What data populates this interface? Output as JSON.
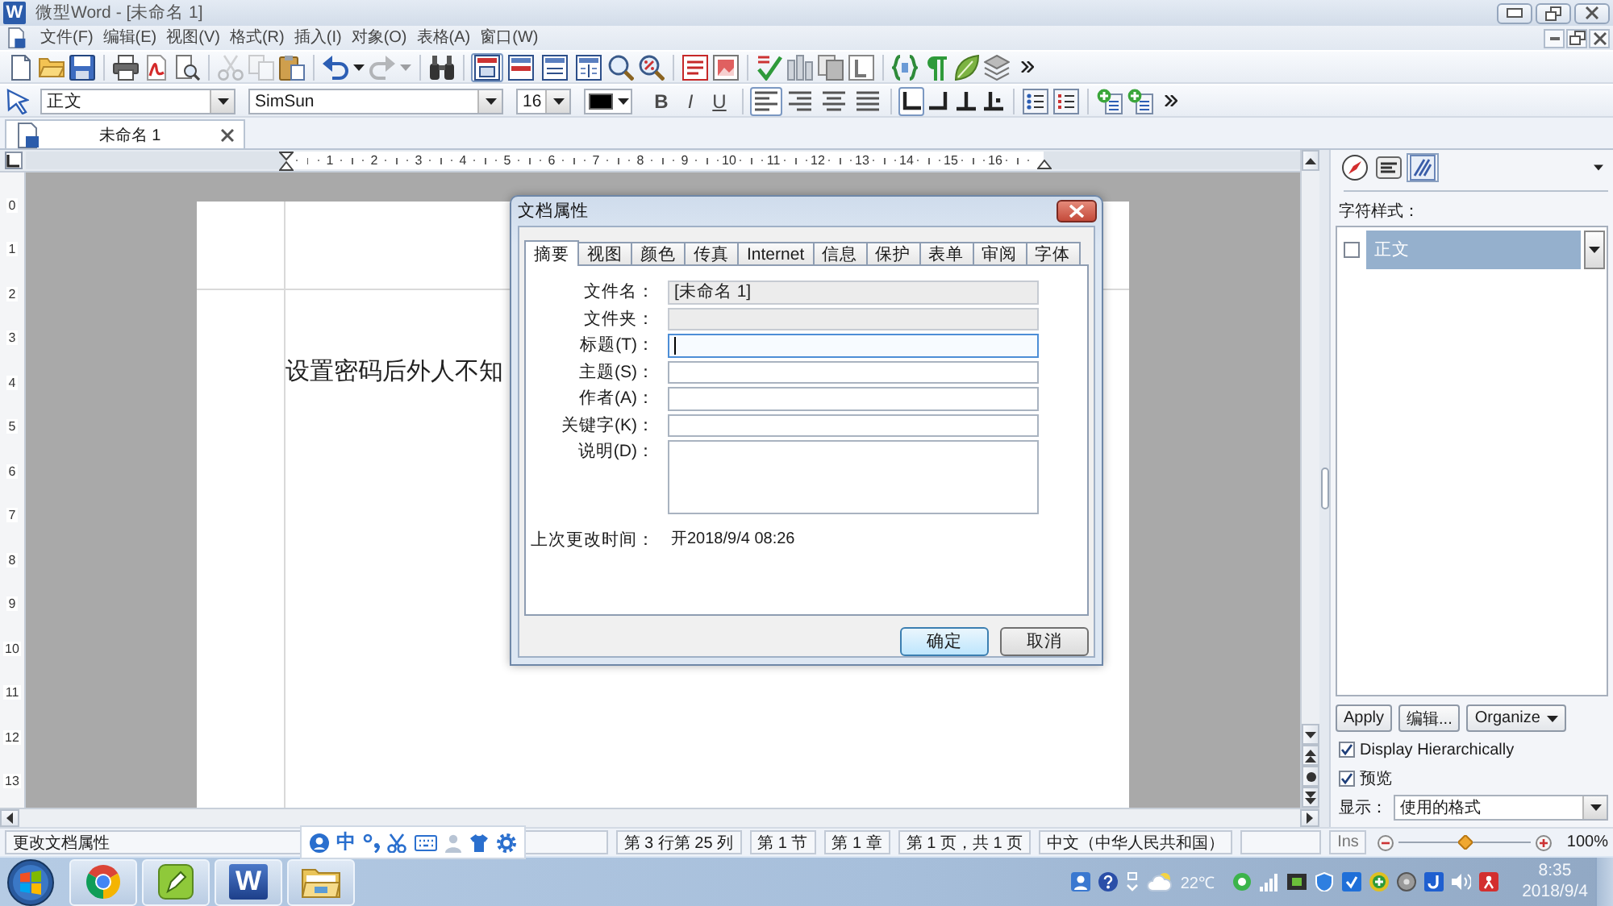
{
  "window": {
    "title": "微型Word - [未命名 1]",
    "app_badge": "W"
  },
  "menu_bar": {
    "items": [
      "文件(F)",
      "编辑(E)",
      "视图(V)",
      "格式(R)",
      "插入(I)",
      "对象(O)",
      "表格(A)",
      "窗口(W)"
    ]
  },
  "standard_toolbar": {
    "groups": [
      [
        {
          "kind": "new",
          "disabled": false
        },
        {
          "kind": "open",
          "disabled": false
        },
        {
          "kind": "save",
          "disabled": false
        }
      ],
      [
        {
          "kind": "print",
          "disabled": false
        },
        {
          "kind": "pdf",
          "disabled": false
        },
        {
          "kind": "preview",
          "disabled": false
        }
      ],
      [
        {
          "kind": "cut",
          "disabled": true
        },
        {
          "kind": "copy",
          "disabled": true
        },
        {
          "kind": "paste",
          "disabled": false
        }
      ],
      [
        {
          "kind": "undo",
          "disabled": false
        },
        {
          "kind": "menu",
          "disabled": false
        },
        {
          "kind": "redo",
          "disabled": true
        },
        {
          "kind": "menu",
          "disabled": true
        }
      ],
      [
        {
          "kind": "find",
          "disabled": false
        }
      ],
      [
        {
          "kind": "page-view",
          "selected": true,
          "disabled": false
        },
        {
          "kind": "web-view",
          "selected": false,
          "disabled": false
        },
        {
          "kind": "outline-view",
          "selected": false,
          "disabled": false
        },
        {
          "kind": "normal-view",
          "selected": false,
          "disabled": false
        },
        {
          "kind": "zoom",
          "disabled": false
        },
        {
          "kind": "zoom-percent",
          "disabled": false
        }
      ],
      [
        {
          "kind": "text-box",
          "disabled": false
        },
        {
          "kind": "image",
          "disabled": false
        }
      ],
      [
        {
          "kind": "spell-check",
          "disabled": false
        },
        {
          "kind": "columns",
          "disabled": false
        },
        {
          "kind": "pages",
          "disabled": false
        },
        {
          "kind": "frame",
          "disabled": false
        }
      ],
      [
        {
          "kind": "braces",
          "disabled": false
        },
        {
          "kind": "pilcrow",
          "disabled": false
        },
        {
          "kind": "leaf",
          "disabled": false
        },
        {
          "kind": "layers",
          "disabled": false
        }
      ]
    ]
  },
  "format_toolbar": {
    "style": "正文",
    "font": "SimSun",
    "size": "16",
    "text_styles": [
      {
        "kind": "bold",
        "label": "B"
      },
      {
        "kind": "italic",
        "label": "I"
      },
      {
        "kind": "underline",
        "label": "U"
      }
    ],
    "alignments": [
      {
        "kind": "left",
        "selected": true
      },
      {
        "kind": "right",
        "selected": false
      },
      {
        "kind": "center",
        "selected": false
      },
      {
        "kind": "justify",
        "selected": false
      }
    ],
    "tab_stops": [
      {
        "kind": "left",
        "selected": true
      },
      {
        "kind": "right",
        "selected": false
      },
      {
        "kind": "center",
        "selected": false
      },
      {
        "kind": "decimal",
        "selected": false
      }
    ]
  },
  "document_tabs": [
    {
      "label": "未命名 1",
      "selected": true
    }
  ],
  "ruler": {
    "numbers": [
      "1",
      "2",
      "3",
      "4",
      "5",
      "6",
      "7",
      "8",
      "9",
      "10",
      "11",
      "12",
      "13",
      "14",
      "15",
      "16"
    ]
  },
  "vertical_ruler": {
    "numbers": [
      "0",
      "1",
      "2",
      "3",
      "4",
      "5",
      "6",
      "7",
      "8",
      "9",
      "10",
      "11",
      "12",
      "13"
    ]
  },
  "document": {
    "text": "设置密码后外人不知"
  },
  "dialog": {
    "title": "文档属性",
    "tabs": [
      {
        "label": "摘要",
        "selected": true
      },
      {
        "label": "视图",
        "selected": false
      },
      {
        "label": "颜色",
        "selected": false
      },
      {
        "label": "传真",
        "selected": false
      },
      {
        "label": "Internet",
        "selected": false
      },
      {
        "label": "信息",
        "selected": false
      },
      {
        "label": "保护",
        "selected": false
      },
      {
        "label": "表单",
        "selected": false
      },
      {
        "label": "审阅",
        "selected": false
      },
      {
        "label": "字体",
        "selected": false
      }
    ],
    "fields": [
      {
        "label": "文件名：",
        "value": "[未命名 1]",
        "kind": "line",
        "disabled": true,
        "focused": false
      },
      {
        "label": "文件夹：",
        "kind": "line",
        "disabled": true,
        "focused": false
      },
      {
        "label": "标题(T)：",
        "kind": "line",
        "disabled": false,
        "focused": true
      },
      {
        "label": "主题(S)：",
        "kind": "line",
        "disabled": false,
        "focused": false
      },
      {
        "label": "作者(A)：",
        "kind": "line",
        "disabled": false,
        "focused": false
      },
      {
        "label": "关键字(K)：",
        "kind": "line",
        "disabled": false,
        "focused": false
      },
      {
        "label": "说明(D)：",
        "kind": "multiline",
        "disabled": false,
        "focused": false
      }
    ],
    "last_modified": {
      "label": "上次更改时间：",
      "value": "开2018/9/4 08:26"
    },
    "buttons": [
      {
        "label": "确定",
        "default": true
      },
      {
        "label": "取消",
        "default": false
      }
    ]
  },
  "styles_panel": {
    "tabs": [
      {
        "kind": "navigator",
        "selected": false
      },
      {
        "kind": "fonts",
        "selected": false
      },
      {
        "kind": "styles",
        "selected": true
      }
    ],
    "heading": "字符样式：",
    "items": [
      {
        "label": "正文",
        "selected": true,
        "checked": false
      }
    ],
    "buttons": [
      {
        "label": "Apply",
        "kind": "plain"
      },
      {
        "label": "编辑...",
        "kind": "plain"
      },
      {
        "label": "Organize",
        "kind": "menu"
      }
    ],
    "options": [
      {
        "label": "Display Hierarchically",
        "checked": true
      },
      {
        "label": "预览",
        "checked": true
      }
    ],
    "show": {
      "label": "显示：",
      "value": "使用的格式"
    }
  },
  "status_bar": {
    "message": "更改文档属性",
    "fields": [
      "第 3 行第 25 列",
      "第 1 节",
      "第 1 章",
      "第 1 页，共 1 页",
      "中文（中华人民共和国）"
    ],
    "mode": "Ins",
    "zoom": {
      "level": 0.5,
      "reading": "100%"
    }
  },
  "ime_bar": {
    "mode": "中"
  },
  "taskbar": {
    "apps": [
      {
        "kind": "browser"
      },
      {
        "kind": "pen"
      },
      {
        "kind": "word",
        "badge": "W"
      },
      {
        "kind": "folder"
      }
    ],
    "weather": "22℃",
    "time": "8:35",
    "date": "2018/9/4"
  }
}
